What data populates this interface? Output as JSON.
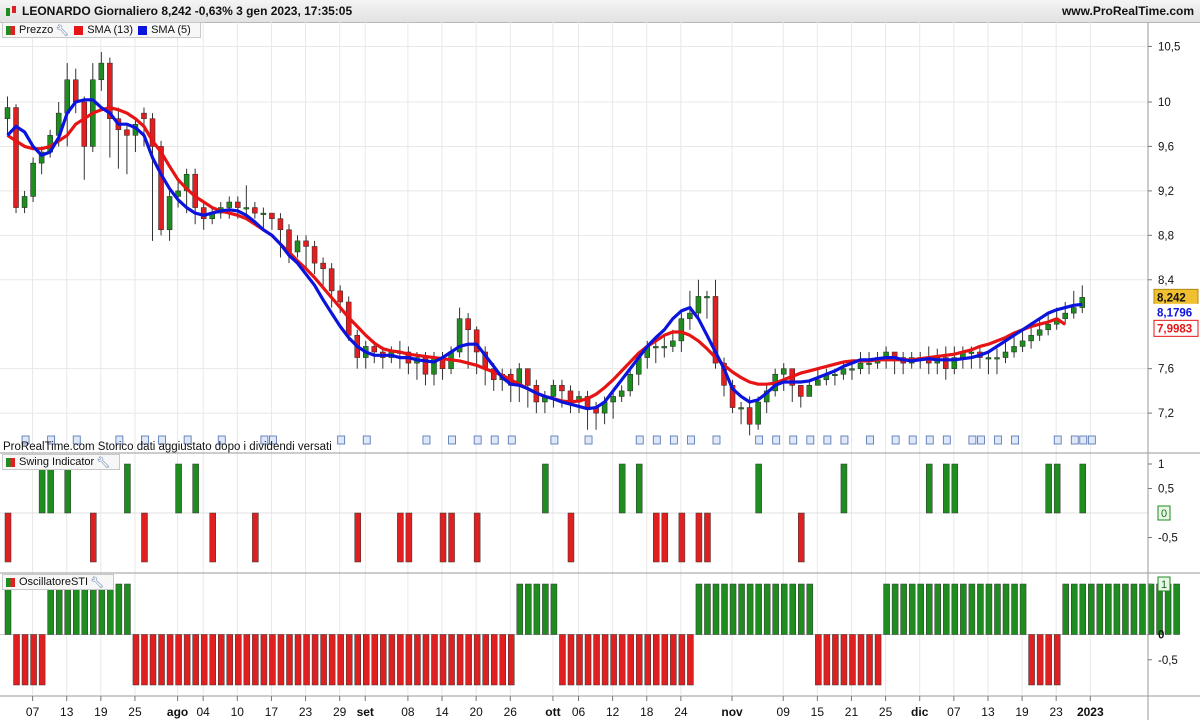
{
  "header": {
    "title": "LEONARDO Giornaliero 8,242 -0,63% 3 gen 2023, 17:35:05",
    "url": "www.ProRealTime.com"
  },
  "legend_price": {
    "items": [
      {
        "label": "Prezzo",
        "color": "split"
      },
      {
        "label": "SMA (13)",
        "color": "#e61414"
      },
      {
        "label": "SMA (5)",
        "color": "#0a14dc"
      }
    ]
  },
  "legend_swing": {
    "label": "Swing Indicator"
  },
  "legend_osc": {
    "label": "OscillatoreSTI"
  },
  "footer_note": "ProRealTime.com Storico dati aggiustato dopo i dividendi versati",
  "colors": {
    "up": "#1e8c1e",
    "down": "#e02020",
    "sma13": "#e61414",
    "sma5": "#0a14dc",
    "last_price_bg": "#f0c030"
  },
  "chart_data": {
    "type": "candlestick",
    "x_tick_labels": [
      {
        "i": 3,
        "label": "07"
      },
      {
        "i": 7,
        "label": "13"
      },
      {
        "i": 11,
        "label": "19"
      },
      {
        "i": 15,
        "label": "25"
      },
      {
        "i": 20,
        "label": "ago"
      },
      {
        "i": 23,
        "label": "04"
      },
      {
        "i": 27,
        "label": "10"
      },
      {
        "i": 31,
        "label": "17"
      },
      {
        "i": 35,
        "label": "23"
      },
      {
        "i": 39,
        "label": "29"
      },
      {
        "i": 42,
        "label": "set"
      },
      {
        "i": 47,
        "label": "08"
      },
      {
        "i": 51,
        "label": "14"
      },
      {
        "i": 55,
        "label": "20"
      },
      {
        "i": 59,
        "label": "26"
      },
      {
        "i": 64,
        "label": "ott"
      },
      {
        "i": 67,
        "label": "06"
      },
      {
        "i": 71,
        "label": "12"
      },
      {
        "i": 75,
        "label": "18"
      },
      {
        "i": 79,
        "label": "24"
      },
      {
        "i": 85,
        "label": "nov"
      },
      {
        "i": 91,
        "label": "09"
      },
      {
        "i": 95,
        "label": "15"
      },
      {
        "i": 99,
        "label": "21"
      },
      {
        "i": 103,
        "label": "25"
      },
      {
        "i": 107,
        "label": "dic"
      },
      {
        "i": 111,
        "label": "07"
      },
      {
        "i": 115,
        "label": "13"
      },
      {
        "i": 119,
        "label": "19"
      },
      {
        "i": 123,
        "label": "23"
      },
      {
        "i": 127,
        "label": "2023"
      }
    ],
    "price_axis": {
      "min": 6.85,
      "max": 10.72,
      "ticks": [
        "10,5",
        "10",
        "9,6",
        "9,2",
        "8,8",
        "8,4",
        "7,6",
        "7,2"
      ],
      "tick_values": [
        10.5,
        10.0,
        9.6,
        9.2,
        8.8,
        8.4,
        7.6,
        7.2
      ]
    },
    "last_labels": {
      "price": "8,242",
      "sma5": "8,1796",
      "sma13": "7,9983"
    },
    "candles": {
      "open": [
        9.85,
        9.95,
        9.05,
        9.15,
        9.45,
        9.55,
        9.7,
        9.9,
        10.2,
        10,
        9.6,
        10.2,
        10.35,
        9.85,
        9.75,
        9.7,
        9.9,
        9.85,
        9.6,
        8.85,
        9.15,
        9.2,
        9.35,
        9.05,
        8.95,
        9,
        9.05,
        9.1,
        9.05,
        9.05,
        9,
        9,
        8.95,
        8.85,
        8.65,
        8.75,
        8.7,
        8.55,
        8.5,
        8.3,
        8.2,
        7.9,
        7.7,
        7.8,
        7.75,
        7.7,
        7.75,
        7.75,
        7.65,
        7.7,
        7.55,
        7.7,
        7.6,
        7.75,
        8.05,
        7.95,
        7.75,
        7.6,
        7.5,
        7.55,
        7.45,
        7.6,
        7.45,
        7.3,
        7.35,
        7.45,
        7.4,
        7.3,
        7.35,
        7.25,
        7.2,
        7.3,
        7.35,
        7.4,
        7.55,
        7.7,
        7.8,
        7.8,
        7.8,
        7.85,
        8.05,
        8.1,
        8.25,
        8.25,
        7.65,
        7.45,
        7.25,
        7.25,
        7.1,
        7.3,
        7.4,
        7.55,
        7.6,
        7.45,
        7.35,
        7.45,
        7.5,
        7.55,
        7.55,
        7.6,
        7.6,
        7.65,
        7.65,
        7.7,
        7.75,
        7.7,
        7.65,
        7.7,
        7.7,
        7.65,
        7.7,
        7.6,
        7.7,
        7.75,
        7.75,
        7.7,
        7.7,
        7.7,
        7.75,
        7.8,
        7.85,
        7.9,
        7.95,
        8.0,
        8.05,
        8.1,
        8.15
      ],
      "close": [
        9.95,
        9.05,
        9.15,
        9.45,
        9.55,
        9.7,
        9.9,
        10.2,
        10,
        9.6,
        10.2,
        10.35,
        9.85,
        9.75,
        9.7,
        9.8,
        9.85,
        9.6,
        8.85,
        9.15,
        9.2,
        9.35,
        9.05,
        8.95,
        9,
        9.05,
        9.1,
        9.05,
        9.05,
        9,
        9,
        8.95,
        8.85,
        8.65,
        8.75,
        8.7,
        8.55,
        8.5,
        8.3,
        8.2,
        7.9,
        7.7,
        7.8,
        7.75,
        7.7,
        7.75,
        7.75,
        7.65,
        7.7,
        7.55,
        7.7,
        7.6,
        7.75,
        8.05,
        7.95,
        7.75,
        7.6,
        7.5,
        7.55,
        7.45,
        7.6,
        7.45,
        7.3,
        7.35,
        7.45,
        7.4,
        7.3,
        7.35,
        7.25,
        7.2,
        7.3,
        7.35,
        7.4,
        7.55,
        7.7,
        7.8,
        7.8,
        7.8,
        7.85,
        8.05,
        8.1,
        8.25,
        8.25,
        7.65,
        7.45,
        7.25,
        7.25,
        7.1,
        7.3,
        7.4,
        7.55,
        7.6,
        7.45,
        7.35,
        7.45,
        7.5,
        7.55,
        7.55,
        7.6,
        7.6,
        7.65,
        7.65,
        7.7,
        7.75,
        7.7,
        7.65,
        7.7,
        7.7,
        7.65,
        7.7,
        7.6,
        7.7,
        7.75,
        7.75,
        7.7,
        7.7,
        7.7,
        7.75,
        7.8,
        7.85,
        7.9,
        7.95,
        8.0,
        8.05,
        8.1,
        8.15,
        8.242
      ],
      "high": [
        10.05,
        9.98,
        9.2,
        9.5,
        9.6,
        9.75,
        10.0,
        10.35,
        10.3,
        10.05,
        10.35,
        10.45,
        10.4,
        9.95,
        9.8,
        9.85,
        9.95,
        9.9,
        9.65,
        9.2,
        9.3,
        9.4,
        9.4,
        9.1,
        9.05,
        9.1,
        9.15,
        9.15,
        9.25,
        9.1,
        9.05,
        9.0,
        9.0,
        8.9,
        8.8,
        8.8,
        8.75,
        8.6,
        8.55,
        8.35,
        8.25,
        7.95,
        7.85,
        7.85,
        7.8,
        7.8,
        7.85,
        7.8,
        7.75,
        7.75,
        7.75,
        7.75,
        7.8,
        8.15,
        8.1,
        7.98,
        7.8,
        7.65,
        7.6,
        7.6,
        7.65,
        7.6,
        7.5,
        7.4,
        7.5,
        7.5,
        7.45,
        7.4,
        7.4,
        7.3,
        7.35,
        7.4,
        7.45,
        7.6,
        7.75,
        7.85,
        7.85,
        7.9,
        7.95,
        8.1,
        8.3,
        8.4,
        8.3,
        8.4,
        7.7,
        7.5,
        7.3,
        7.35,
        7.35,
        7.45,
        7.6,
        7.65,
        7.55,
        7.45,
        7.5,
        7.6,
        7.6,
        7.6,
        7.65,
        7.65,
        7.75,
        7.75,
        7.75,
        7.8,
        7.75,
        7.75,
        7.75,
        7.75,
        7.8,
        7.78,
        7.8,
        7.8,
        7.8,
        7.8,
        7.8,
        7.75,
        7.78,
        7.85,
        7.92,
        7.95,
        8.0,
        8.05,
        8.1,
        8.15,
        8.2,
        8.3,
        8.35
      ],
      "low": [
        9.7,
        9.0,
        9.0,
        9.1,
        9.35,
        9.5,
        9.6,
        9.6,
        9.9,
        9.3,
        9.55,
        10.1,
        9.5,
        9.4,
        9.35,
        9.55,
        9.6,
        8.75,
        8.8,
        8.75,
        9.05,
        9.0,
        8.9,
        8.85,
        8.9,
        8.95,
        8.95,
        8.95,
        8.95,
        8.95,
        8.85,
        8.85,
        8.6,
        8.55,
        8.6,
        8.5,
        8.45,
        8.35,
        8.15,
        8.1,
        7.85,
        7.6,
        7.6,
        7.65,
        7.6,
        7.65,
        7.6,
        7.55,
        7.5,
        7.45,
        7.45,
        7.5,
        7.55,
        7.7,
        7.6,
        7.55,
        7.45,
        7.4,
        7.4,
        7.3,
        7.3,
        7.25,
        7.2,
        7.2,
        7.25,
        7.25,
        7.2,
        7.2,
        7.05,
        7.05,
        7.1,
        7.15,
        7.3,
        7.35,
        7.45,
        7.6,
        7.65,
        7.7,
        7.75,
        7.75,
        7.95,
        8.05,
        8.05,
        7.6,
        7.35,
        7.2,
        7.1,
        7.0,
        7.05,
        7.2,
        7.35,
        7.4,
        7.3,
        7.25,
        7.35,
        7.45,
        7.45,
        7.45,
        7.5,
        7.5,
        7.55,
        7.55,
        7.6,
        7.6,
        7.55,
        7.55,
        7.6,
        7.6,
        7.55,
        7.55,
        7.5,
        7.55,
        7.6,
        7.6,
        7.6,
        7.55,
        7.55,
        7.65,
        7.7,
        7.75,
        7.78,
        7.85,
        7.9,
        7.95,
        8.0,
        8.05,
        8.1
      ],
      "sma5": [
        9.7,
        9.78,
        9.73,
        9.6,
        9.52,
        9.55,
        9.68,
        9.9,
        10.0,
        10.02,
        10.02,
        9.95,
        9.9,
        9.8,
        9.8,
        9.77,
        9.7,
        9.5,
        9.35,
        9.22,
        9.12,
        9.05,
        9.0,
        8.98,
        9.0,
        9.02,
        9.03,
        9.02,
        8.98,
        8.92,
        8.85,
        8.8,
        8.72,
        8.62,
        8.55,
        8.45,
        8.35,
        8.22,
        8.1,
        7.98,
        7.88,
        7.8,
        7.75,
        7.72,
        7.72,
        7.72,
        7.7,
        7.7,
        7.68,
        7.67,
        7.66,
        7.7,
        7.75,
        7.8,
        7.82,
        7.82,
        7.72,
        7.62,
        7.52,
        7.46,
        7.45,
        7.42,
        7.38,
        7.35,
        7.33,
        7.3,
        7.28,
        7.26,
        7.24,
        7.25,
        7.3,
        7.4,
        7.5,
        7.6,
        7.7,
        7.8,
        7.88,
        7.95,
        8.05,
        8.12,
        8.15,
        8.05,
        7.9,
        7.75,
        7.6,
        7.42,
        7.35,
        7.3,
        7.32,
        7.38,
        7.45,
        7.48,
        7.48,
        7.48,
        7.49,
        7.52,
        7.55,
        7.58,
        7.62,
        7.65,
        7.68,
        7.68,
        7.69,
        7.7,
        7.7,
        7.68,
        7.67,
        7.68,
        7.69,
        7.68,
        7.68,
        7.68,
        7.69,
        7.7,
        7.72,
        7.75,
        7.8,
        7.85,
        7.9,
        7.95,
        8.0,
        8.05,
        8.1,
        8.13,
        8.15,
        8.17,
        8.1796
      ],
      "sma13": [
        9.7,
        9.65,
        9.6,
        9.58,
        9.58,
        9.6,
        9.65,
        9.7,
        9.8,
        9.85,
        9.9,
        9.93,
        9.95,
        9.93,
        9.9,
        9.85,
        9.78,
        9.65,
        9.55,
        9.42,
        9.3,
        9.22,
        9.15,
        9.1,
        9.05,
        9.02,
        9.0,
        8.98,
        8.95,
        8.9,
        8.85,
        8.8,
        8.72,
        8.65,
        8.57,
        8.5,
        8.42,
        8.33,
        8.24,
        8.15,
        8.06,
        7.98,
        7.9,
        7.83,
        7.78,
        7.76,
        7.75,
        7.73,
        7.72,
        7.71,
        7.7,
        7.69,
        7.68,
        7.67,
        7.65,
        7.63,
        7.6,
        7.57,
        7.54,
        7.5,
        7.46,
        7.42,
        7.38,
        7.35,
        7.33,
        7.31,
        7.3,
        7.31,
        7.33,
        7.37,
        7.43,
        7.5,
        7.58,
        7.66,
        7.74,
        7.8,
        7.85,
        7.9,
        7.93,
        7.93,
        7.9,
        7.85,
        7.78,
        7.7,
        7.63,
        7.57,
        7.52,
        7.48,
        7.46,
        7.46,
        7.47,
        7.5,
        7.53,
        7.56,
        7.58,
        7.6,
        7.62,
        7.64,
        7.66,
        7.67,
        7.67,
        7.67,
        7.68,
        7.68,
        7.68,
        7.68,
        7.68,
        7.69,
        7.7,
        7.71,
        7.72,
        7.73,
        7.75,
        7.77,
        7.8,
        7.82,
        7.85,
        7.88,
        7.92,
        7.95,
        7.98,
        8.0,
        8.02,
        8.05,
        7.9983
      ]
    },
    "swing_indicator": {
      "axis_ticks": [
        "1",
        "0,5",
        "-0,5"
      ],
      "last_value": "0",
      "bars": [
        -1,
        0,
        0,
        0,
        1,
        1,
        0,
        1,
        0,
        0,
        -1,
        0,
        0,
        0,
        1,
        0,
        -1,
        0,
        0,
        0,
        1,
        0,
        1,
        0,
        -1,
        0,
        0,
        0,
        0,
        -1,
        0,
        0,
        0,
        0,
        0,
        0,
        0,
        0,
        0,
        0,
        0,
        -1,
        0,
        0,
        0,
        0,
        -1,
        -1,
        0,
        0,
        0,
        -1,
        -1,
        0,
        0,
        -1,
        0,
        0,
        0,
        0,
        0,
        0,
        0,
        1,
        0,
        0,
        -1,
        0,
        0,
        0,
        0,
        0,
        1,
        0,
        1,
        0,
        -1,
        -1,
        0,
        -1,
        0,
        -1,
        -1,
        0,
        0,
        0,
        0,
        0,
        1,
        0,
        0,
        0,
        0,
        -1,
        0,
        0,
        0,
        0,
        1,
        0,
        0,
        0,
        0,
        0,
        0,
        0,
        0,
        0,
        1,
        0,
        1,
        1,
        0,
        0,
        0,
        0,
        0,
        0,
        0,
        0,
        0,
        0,
        1,
        1,
        0,
        0,
        1,
        0,
        -1,
        1,
        0,
        -1,
        1,
        0,
        -1,
        0,
        0,
        1,
        1,
        0,
        1,
        0,
        1,
        0,
        1,
        1,
        -1,
        0,
        0,
        1,
        0,
        -1,
        0,
        0,
        0,
        0,
        1,
        0,
        1,
        0,
        -1,
        1,
        0,
        0,
        1,
        0,
        0,
        0,
        1,
        0,
        0,
        0,
        0,
        1
      ]
    },
    "sti_oscillator": {
      "axis_ticks": [
        "1",
        "0",
        "-0,5"
      ],
      "last_value": "1",
      "bars": [
        1,
        -1,
        -1,
        -1,
        -1,
        1,
        1,
        1,
        1,
        1,
        1,
        1,
        1,
        1,
        1,
        -1,
        -1,
        -1,
        -1,
        -1,
        -1,
        -1,
        -1,
        -1,
        -1,
        -1,
        -1,
        -1,
        -1,
        -1,
        -1,
        -1,
        -1,
        -1,
        -1,
        -1,
        -1,
        -1,
        -1,
        -1,
        -1,
        -1,
        -1,
        -1,
        -1,
        -1,
        -1,
        -1,
        -1,
        -1,
        -1,
        -1,
        -1,
        -1,
        -1,
        -1,
        -1,
        -1,
        -1,
        -1,
        1,
        1,
        1,
        1,
        1,
        -1,
        -1,
        -1,
        -1,
        -1,
        -1,
        -1,
        -1,
        -1,
        -1,
        -1,
        -1,
        -1,
        -1,
        -1,
        -1,
        1,
        1,
        1,
        1,
        1,
        1,
        1,
        1,
        1,
        1,
        1,
        1,
        1,
        1,
        -1,
        -1,
        -1,
        -1,
        -1,
        -1,
        -1,
        -1,
        1,
        1,
        1,
        1,
        1,
        1,
        1,
        1,
        1,
        1,
        1,
        1,
        1,
        1,
        1,
        1,
        1,
        -1,
        -1,
        -1,
        -1,
        1,
        1,
        1,
        1,
        1,
        1,
        1,
        1,
        1,
        1,
        1,
        1,
        1,
        1
      ]
    }
  }
}
